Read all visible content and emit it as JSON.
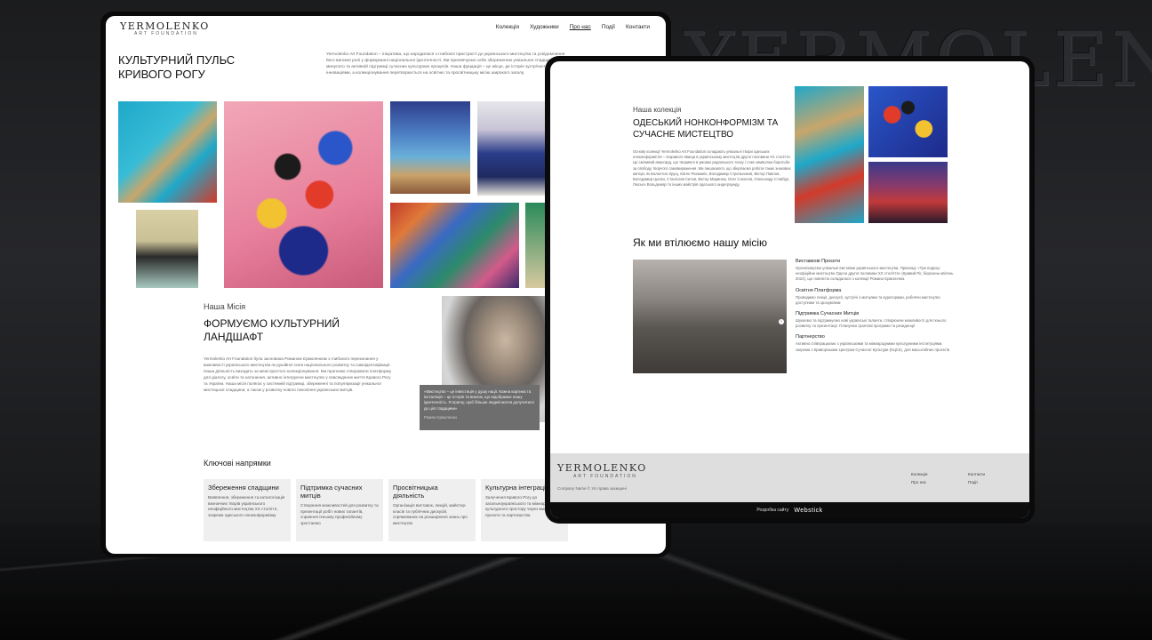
{
  "wall_text": "YERMOLENKO",
  "left": {
    "logo": {
      "main": "YERMOLENKO",
      "sub": "ART FOUNDATION"
    },
    "nav": [
      "Колекція",
      "Художники",
      "Про нас",
      "Події",
      "Контакти"
    ],
    "hero_title": "КУЛЬТУРНИЙ ПУЛЬС КРИВОГО РОГУ",
    "intro": "Yermolenko Art Foundation – ініціатива, що народилася з глибокої пристрасті до українського мистецтва та усвідомлення його вагомої ролі у формуванні національної ідентичності. Ми присвячуємо себе збереженню унікальної спадщини минулого та активній підтримці сучасних культурних процесів. Наша фундація – це місце, де історія зустрічається з інноваціями, а колекціонування перетворюється на освітню та просвітницьку місію широкого загалу.",
    "mission_label": "Наша Місія",
    "mission_title": "ФОРМУЄМО КУЛЬТУРНИЙ ЛАНДШАФТ",
    "mission_text": "Yermolenko Art Foundation була заснована Романом Єрмоленком з глибокого переконання у важливості українського мистецтва як рушійної сили національного розвитку та самоідентифікації. Наша діяльність виходить за межі простого колекціонування. Ми прагнемо створювати платформу для діалогу, освіти та натхнення, активно інтегруючи мистецтво у повсякденне життя Кривого Рогу та України. Наша місія полягає у системній підтримці, збереженні та популяризації унікальної мистецької спадщини, а також у розвитку нового покоління українських митців.",
    "quote": "«Мистецтво – це інвестиція у душу нації. Кожна картина та інсталяція – це історія та виклик, що відображає нашу ідентичність. Я прагну, щоб більше людей могли долучитися до цієї спадщини»",
    "quote_author": "Роман Єрмоленко",
    "directions_title": "Ключові напрямки",
    "cards": [
      {
        "title": "Збереження спадщини",
        "text": "Виявлення, збереження та каталогізація визначних творів українського неофіційного мистецтва XX століття, зокрема одеського нонконформізму"
      },
      {
        "title": "Підтримка сучасних митців",
        "text": "Створення можливостей для розвитку та презентації робіт нових талантів, сприяння їхньому професійному зростанню"
      },
      {
        "title": "Просвітницька діяльність",
        "text": "Організація виставок, лекцій, майстер-класів та публічних дискусій, спрямованих на розширення знань про мистецтво"
      },
      {
        "title": "Культурна інтеграція",
        "text": "Залучення Кривого Рогу до загальноукраїнського та міжнародного культурного простору через мистецькі проєкти та партнерства"
      }
    ]
  },
  "right": {
    "collection_label": "Наша колекція",
    "collection_title": "ОДЕСЬКИЙ НОНКОНФОРМІЗМ ТА СУЧАСНЕ МИСТЕЦТВО",
    "collection_text": "Основу колекції Yermolenko Art Foundation складають унікальні твори одеських нонконформістів – яскравого явища в українському мистецтві другої половини XX століття. Це сміливий авангард, що творився в умовах радянського тиску і став символом боротьби за свободу творчого самовираження. Ми пишаємося, що зберігаємо роботи таких знакових митців, як Валентин Хрущ, Євген Рахманін, Володимир Стрельников, Віктор Павлов, Володимир Цюпко, Станіслав Сичов, Віктор Маринюк, Олег Соколов, Олександр Стовбур, Люсьєн Вольдемар та інших майстрів одеського андеграунду.",
    "mission_title": "Як ми втілюємо нашу місію",
    "items": [
      {
        "title": "Виставкові Проєкти",
        "text": "Організовуємо унікальні виставки українського мистецтва. Приклад: «Три подиху: неофіційне мистецтво Одеси другої половини XX століття» (Кривий Ріг, березень-квітень 2024), що повністю складалася з колекції Романа Єрмоленка"
      },
      {
        "title": "Освітня Платформа",
        "text": "Проводимо лекції, дискусії, зустрічі з митцями та кураторами, роблячи мистецтво доступним та зрозумілим"
      },
      {
        "title": "Підтримка Сучасних Митців",
        "text": "Шукаємо та підтримуємо нові українські таланти, створюючи можливості для їхнього розвитку та презентації. Плануємо грантові програми та резиденції"
      },
      {
        "title": "Партнерство",
        "text": "Активно співпрацюємо з українськими та міжнародними культурними інституціями, зокрема з Криворізьким Центром Сучасної Культури (КЦСК), для масштабних проєктів"
      }
    ],
    "footer": {
      "logo_main": "YERMOLENKO",
      "logo_sub": "ART FOUNDATION",
      "copyright": "Company Name © Усі права захищені",
      "links_col1": [
        "Колекція",
        "Про нас"
      ],
      "links_col2": [
        "Контакти",
        "Події"
      ]
    },
    "dev_label": "Розробка сайту",
    "dev_brand": "Webstick"
  }
}
